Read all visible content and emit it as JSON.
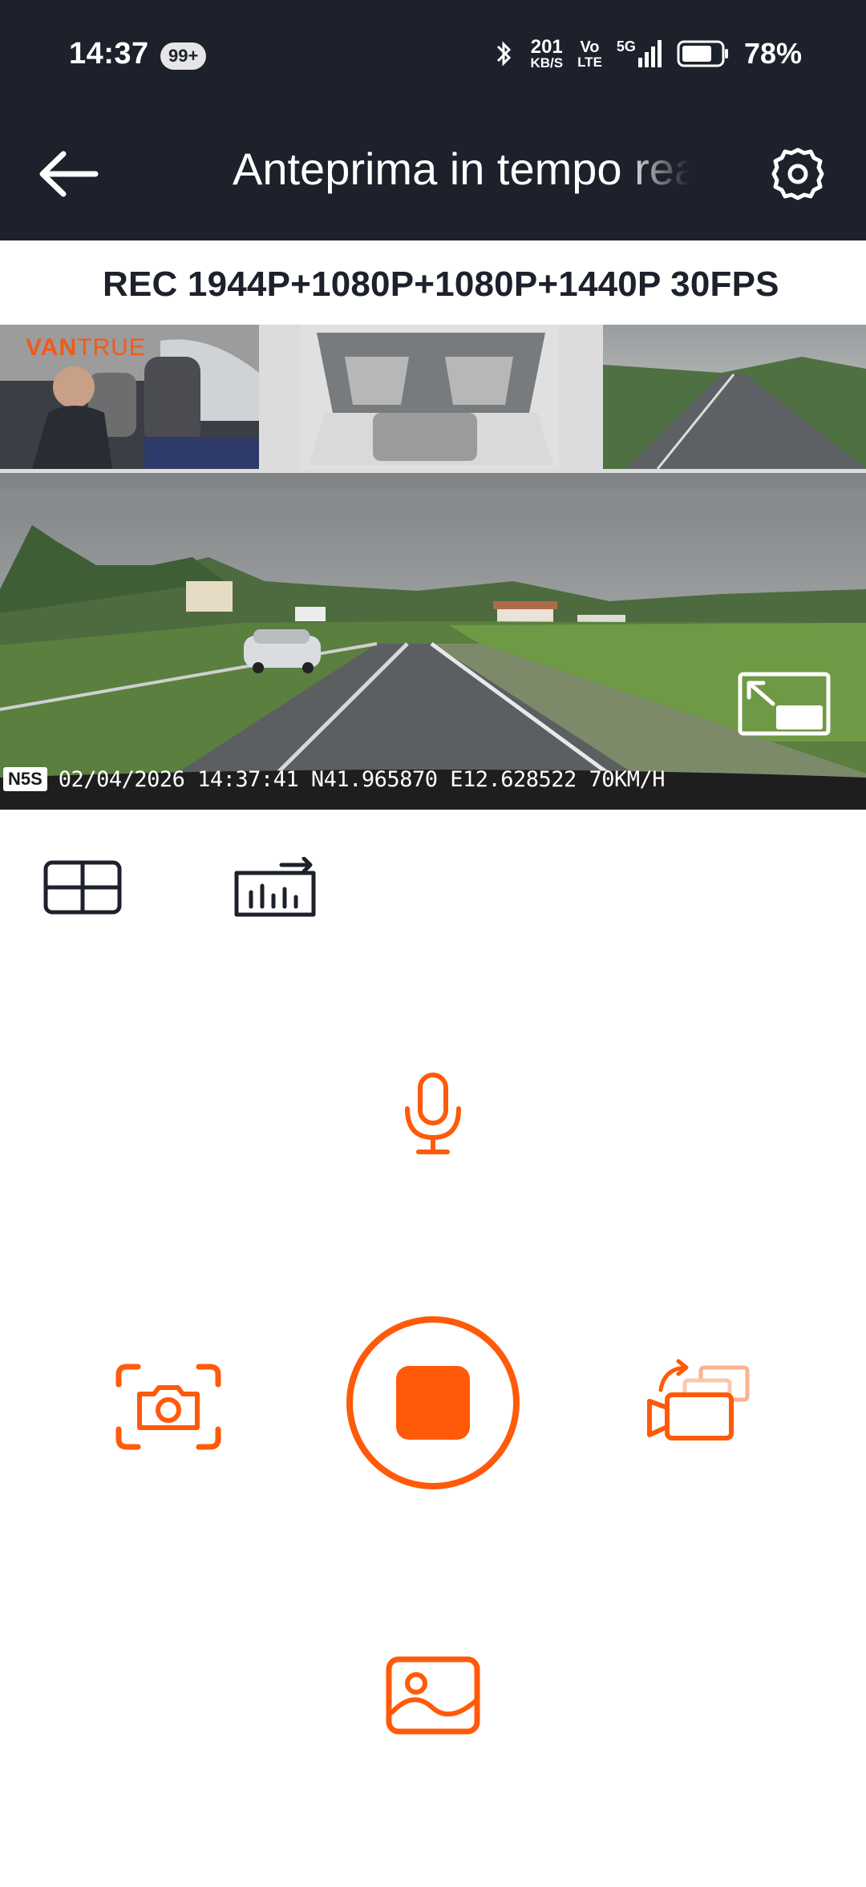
{
  "status_bar": {
    "time": "14:37",
    "notification_badge": "99+",
    "net_speed_value": "201",
    "net_speed_unit": "KB/S",
    "volte_top": "Vo",
    "volte_bottom": "LTE",
    "network_type": "5G",
    "battery_percent": "78%",
    "battery_level": 0.78
  },
  "app_bar": {
    "title": "Anteprima in tempo reale",
    "back_icon": "arrow-left-icon",
    "settings_icon": "gear-icon"
  },
  "recording_info": {
    "text": "REC 1944P+1080P+1080P+1440P 30FPS"
  },
  "preview": {
    "brand_primary": "VAN",
    "brand_secondary": "TRUE",
    "model_chip": "N5S",
    "overlay_text": "02/04/2026 14:37:41 N41.965870 E12.628522 70KM/H",
    "pip_icon": "picture-in-picture-exit-icon"
  },
  "tools": {
    "layout_icon": "grid-layout-icon",
    "bitrate_icon": "bitrate-chart-icon"
  },
  "controls": {
    "mic_icon": "microphone-icon",
    "snapshot_icon": "camera-snapshot-icon",
    "record_icon": "stop-record-icon",
    "switch_icon": "switch-camera-icon",
    "gallery_icon": "gallery-icon"
  },
  "colors": {
    "accent": "#ff5a0a",
    "header_bg": "#1c212b",
    "text_dark": "#1c212b"
  }
}
